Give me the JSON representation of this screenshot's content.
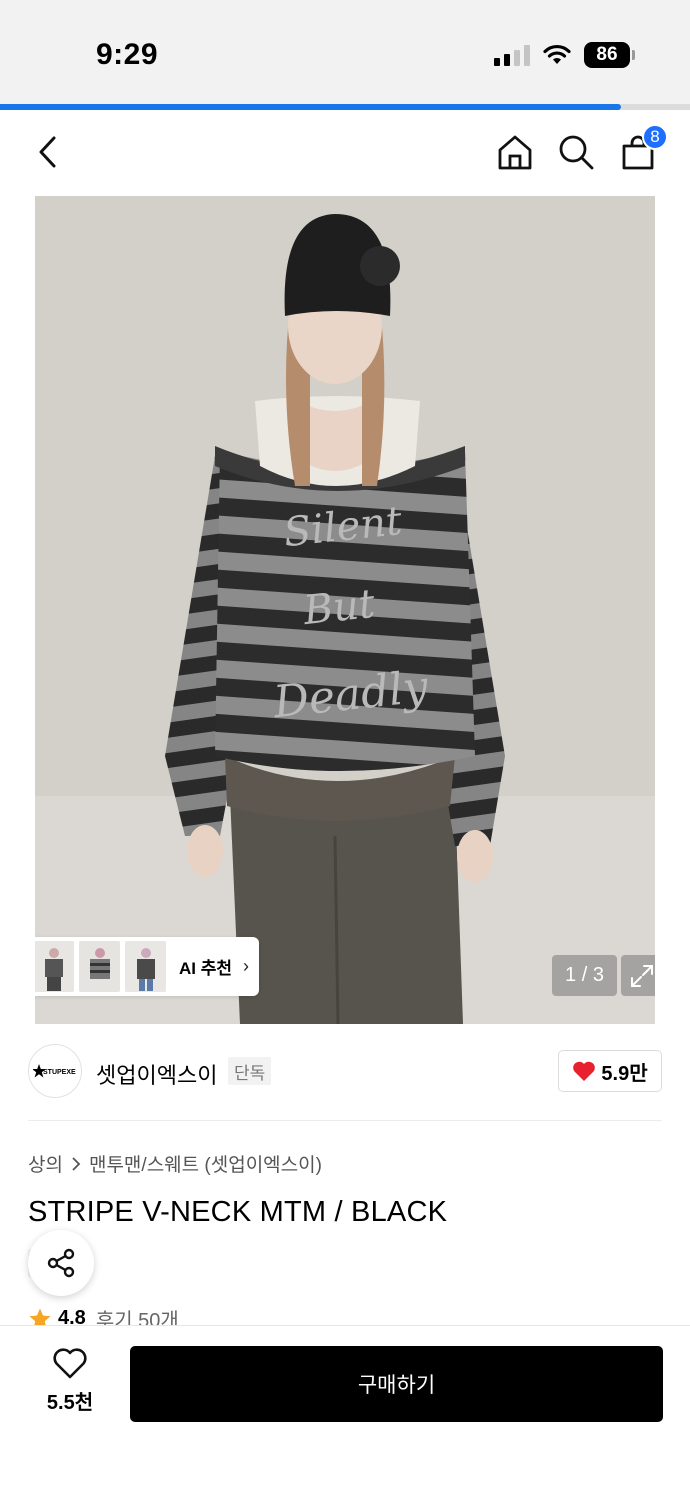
{
  "status_bar": {
    "time": "9:29",
    "battery": "86"
  },
  "page_progress": 0.9,
  "nav": {
    "cart_count": "8",
    "icons": [
      "back-arrow-icon",
      "home-icon",
      "search-icon",
      "shopping-bag-icon"
    ]
  },
  "hero": {
    "page_counter": "1 / 3",
    "ai_recommend_label": "AI 추천",
    "ai_recommend_arrow": "›",
    "image_text_lines": [
      "Silent",
      "But",
      "Deadly"
    ]
  },
  "brand": {
    "logo_text": "STUPEXE",
    "name": "셋업이엑스이",
    "tag": "단독",
    "likes": "5.9만",
    "accent_color": "#e8212e"
  },
  "product": {
    "breadcrumb": [
      "상의",
      "맨투맨/스웨트 (셋업이엑스이)"
    ],
    "title": "STRIPE V-NECK MTM / BLACK",
    "tag": "단독",
    "rating": "4.8",
    "review_label": "후기 50개"
  },
  "bottom_bar": {
    "wish_count": "5.5천",
    "buy_label": "구매하기"
  },
  "colors": {
    "progress": "#1877e8",
    "badge": "#1f6fff",
    "star": "#f5a623",
    "buy_button": "#000000"
  }
}
